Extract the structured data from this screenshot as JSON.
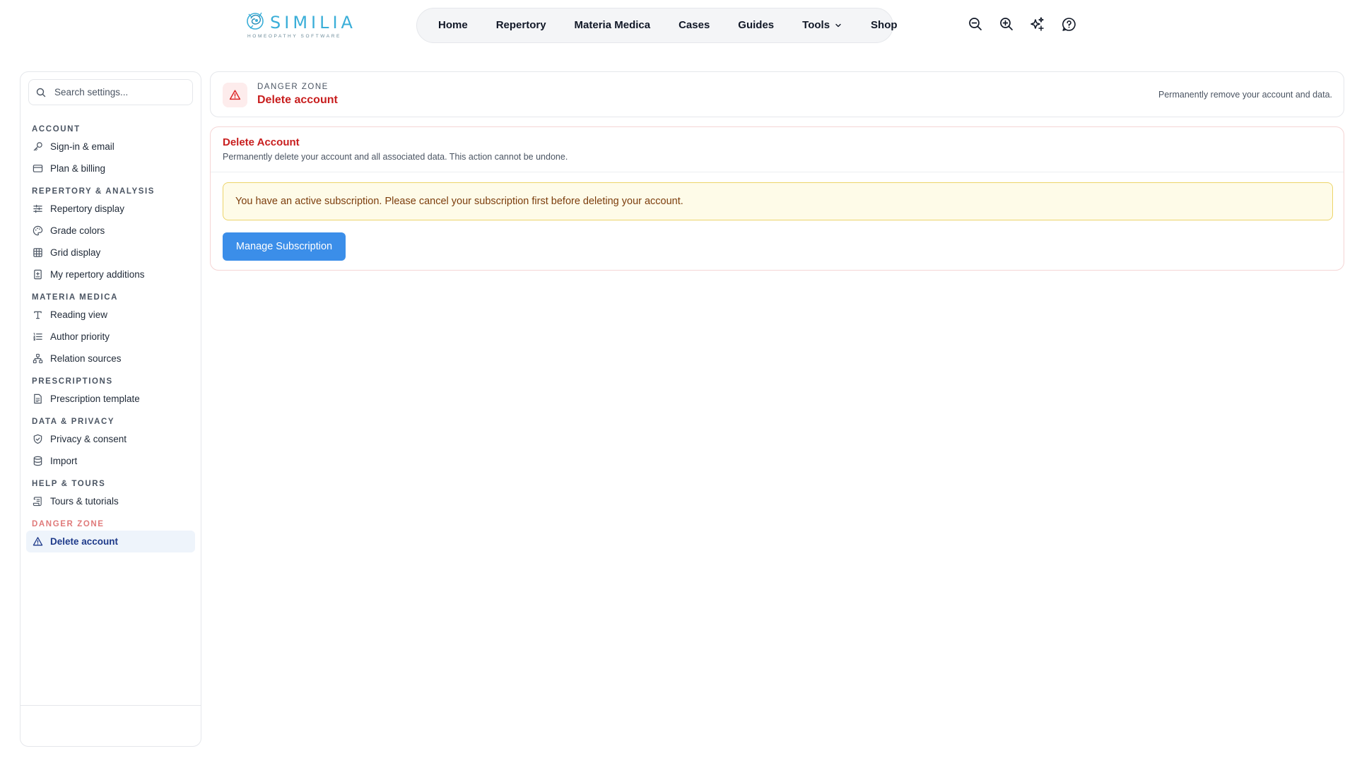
{
  "brand": {
    "name": "SIMILIA",
    "tagline": "HOMEOPATHY SOFTWARE",
    "color": "#3aaed8"
  },
  "nav": {
    "items": [
      {
        "label": "Home"
      },
      {
        "label": "Repertory"
      },
      {
        "label": "Materia Medica"
      },
      {
        "label": "Cases"
      },
      {
        "label": "Guides"
      },
      {
        "label": "Tools",
        "has_dropdown": true
      },
      {
        "label": "Shop"
      }
    ]
  },
  "toolbar_icons": [
    "zoom-out-icon",
    "zoom-in-icon",
    "sparkles-icon",
    "help-icon"
  ],
  "sidebar": {
    "search_placeholder": "Search settings...",
    "sections": [
      {
        "title": "ACCOUNT",
        "items": [
          {
            "label": "Sign-in & email",
            "icon": "key-icon"
          },
          {
            "label": "Plan & billing",
            "icon": "credit-card-icon"
          }
        ]
      },
      {
        "title": "REPERTORY & ANALYSIS",
        "items": [
          {
            "label": "Repertory display",
            "icon": "sliders-icon"
          },
          {
            "label": "Grade colors",
            "icon": "palette-icon"
          },
          {
            "label": "Grid display",
            "icon": "grid-icon"
          },
          {
            "label": "My repertory additions",
            "icon": "book-plus-icon"
          }
        ]
      },
      {
        "title": "MATERIA MEDICA",
        "items": [
          {
            "label": "Reading view",
            "icon": "type-icon"
          },
          {
            "label": "Author priority",
            "icon": "list-ordered-icon"
          },
          {
            "label": "Relation sources",
            "icon": "network-icon"
          }
        ]
      },
      {
        "title": "PRESCRIPTIONS",
        "items": [
          {
            "label": "Prescription template",
            "icon": "file-text-icon"
          }
        ]
      },
      {
        "title": "DATA & PRIVACY",
        "items": [
          {
            "label": "Privacy & consent",
            "icon": "shield-check-icon"
          },
          {
            "label": "Import",
            "icon": "database-icon"
          }
        ]
      },
      {
        "title": "HELP & TOURS",
        "items": [
          {
            "label": "Tours & tutorials",
            "icon": "scroll-icon"
          }
        ]
      },
      {
        "title": "DANGER ZONE",
        "danger": true,
        "items": [
          {
            "label": "Delete account",
            "icon": "alert-triangle-icon",
            "active": true
          }
        ]
      }
    ]
  },
  "header": {
    "kicker": "DANGER ZONE",
    "title": "Delete account",
    "description": "Permanently remove your account and data."
  },
  "delete_card": {
    "title": "Delete Account",
    "subtitle": "Permanently delete your account and all associated data. This action cannot be undone.",
    "warning": "You have an active subscription. Please cancel your subscription first before deleting your account.",
    "button_label": "Manage Subscription"
  },
  "colors": {
    "danger": "#c81e1e",
    "primary_button": "#3b8ee9",
    "warning_bg": "#fefbe8",
    "warning_border": "#ecd46a",
    "active_item_bg": "#eef4fb"
  }
}
